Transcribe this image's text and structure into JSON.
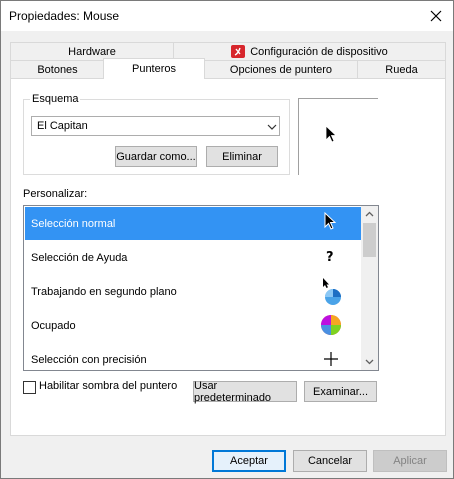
{
  "window": {
    "title": "Propiedades: Mouse"
  },
  "tabs": {
    "back_row": [
      {
        "label": "Hardware"
      },
      {
        "label": "Configuración de dispositivo",
        "icon": "synaptics-icon"
      }
    ],
    "front_row": [
      {
        "label": "Botones"
      },
      {
        "label": "Punteros",
        "active": true
      },
      {
        "label": "Opciones de puntero"
      },
      {
        "label": "Rueda"
      }
    ]
  },
  "scheme": {
    "group_label": "Esquema",
    "selected": "El Capitan",
    "save_button": "Guardar como...",
    "delete_button": "Eliminar"
  },
  "customize": {
    "label": "Personalizar:",
    "items": [
      {
        "label": "Selección normal",
        "icon": "arrow-cursor-icon",
        "selected": true
      },
      {
        "label": "Selección de Ayuda",
        "icon": "help-cursor-icon"
      },
      {
        "label": "Trabajando en segundo plano",
        "icon": "working-in-background-cursor-icon"
      },
      {
        "label": "Ocupado",
        "icon": "busy-spinner-cursor-icon"
      },
      {
        "label": "Selección con precisión",
        "icon": "crosshair-cursor-icon"
      }
    ]
  },
  "shadow_checkbox": {
    "label": "Habilitar sombra del puntero",
    "checked": false
  },
  "buttons": {
    "use_default": "Usar predeterminado",
    "browse": "Examinar...",
    "ok": "Aceptar",
    "cancel": "Cancelar",
    "apply": "Aplicar"
  },
  "colors": {
    "selection": "#3393f3",
    "default_button_border": "#0078d7",
    "synaptics_red": "#d7262c"
  }
}
